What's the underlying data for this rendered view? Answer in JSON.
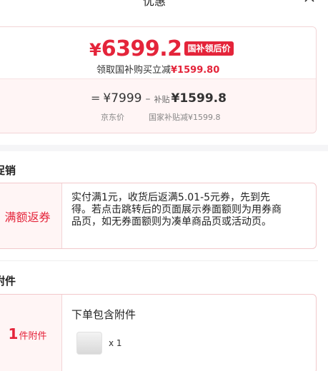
{
  "header": {
    "title": "优惠"
  },
  "price_card": {
    "currency": "¥",
    "final_price": "6399.2",
    "tag": "国补领后价",
    "subsidy_prefix": "领取国补购买立减",
    "subsidy_amount": "¥1599.80",
    "formula": {
      "equals": "=",
      "jd_price": "¥7999",
      "minus": "–",
      "subsidy_label": "补贴",
      "subsidy_value": "¥1599.8"
    },
    "captions": {
      "jd_price": "京东价",
      "national_subsidy": "国家补贴减¥1599.8"
    }
  },
  "promotion": {
    "section_title": "促销",
    "name": "满额返券",
    "description": "实付满1元，收货后返满5.01-5元券，先到先得。若点击跳转后的页面展示券面额则为用券商品页，如无券面额则为凑单商品页或活动页。"
  },
  "accessories": {
    "section_title": "附件",
    "count": "1",
    "unit": "件附件",
    "heading": "下单包含附件",
    "item_qty": "x 1"
  },
  "colors": {
    "accent": "#e4243a",
    "card_tint": "#fff5f5",
    "border": "#f2c8cb"
  }
}
